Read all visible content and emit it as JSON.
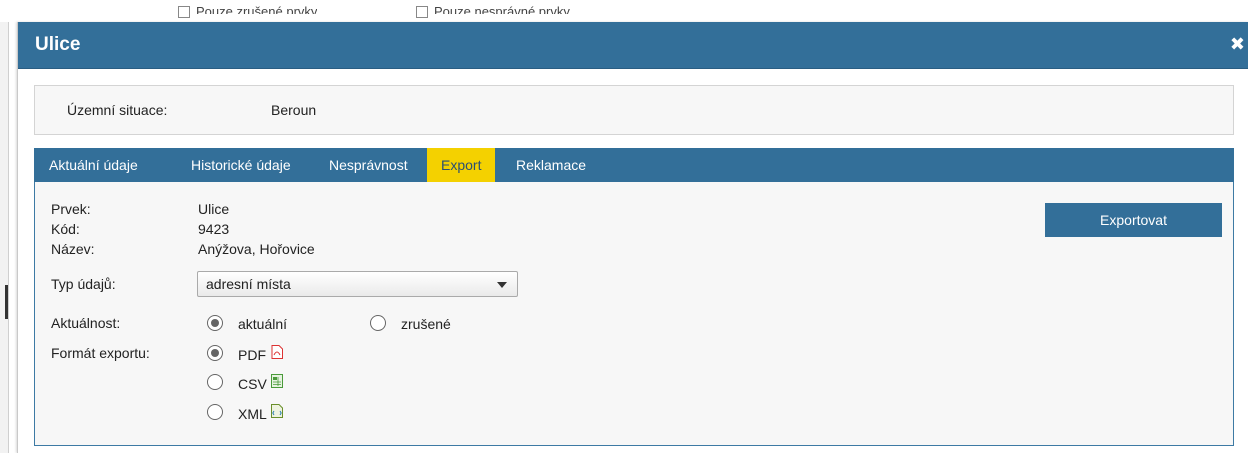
{
  "background": {
    "fragments": [
      "Pouze zrušené prvky",
      "Pouze nesprávné prvky"
    ]
  },
  "dialog": {
    "title": "Ulice",
    "close_symbol": "✖",
    "situation": {
      "label": "Územní situace:",
      "value": "Beroun"
    },
    "tabs": [
      {
        "label": "Aktuální údaje",
        "active": false
      },
      {
        "label": "Historické údaje",
        "active": false
      },
      {
        "label": "Nesprávnost",
        "active": false
      },
      {
        "label": "Export",
        "active": true
      },
      {
        "label": "Reklamace",
        "active": false
      }
    ],
    "details": {
      "prvek_label": "Prvek:",
      "prvek_value": "Ulice",
      "kod_label": "Kód:",
      "kod_value": "9423",
      "nazev_label": "Název:",
      "nazev_value": "Anýžova, Hořovice"
    },
    "typ_udaju": {
      "label": "Typ údajů:",
      "selected": "adresní místa"
    },
    "aktualnost": {
      "label": "Aktuálnost:",
      "options": [
        {
          "label": "aktuální",
          "checked": true
        },
        {
          "label": "zrušené",
          "checked": false
        }
      ]
    },
    "format": {
      "label": "Formát exportu:",
      "options": [
        {
          "label": "PDF",
          "checked": true,
          "icon": "pdf-file-icon"
        },
        {
          "label": "CSV",
          "checked": false,
          "icon": "csv-file-icon"
        },
        {
          "label": "XML",
          "checked": false,
          "icon": "xml-file-icon"
        }
      ]
    },
    "export_button": "Exportovat"
  },
  "colors": {
    "header_blue": "#336f99",
    "active_tab": "#f4d100",
    "panel_bg": "#f7f7f7"
  }
}
